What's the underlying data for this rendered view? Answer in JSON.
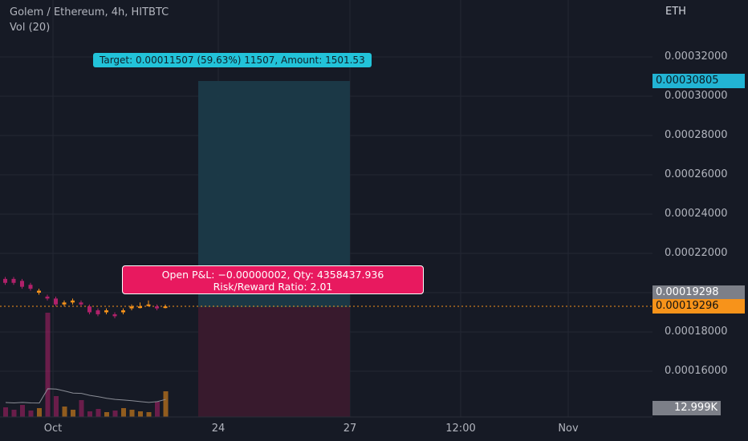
{
  "header": {
    "title": "Golem / Ethereum, 4h, HITBTC",
    "indicator": "Vol (20)"
  },
  "axis": {
    "currency": "ETH",
    "y_ticks": [
      "0.00032000",
      "0.00030000",
      "0.00028000",
      "0.00026000",
      "0.00024000",
      "0.00022000",
      "0.00018000",
      "0.00016000"
    ],
    "x_ticks": [
      "Oct",
      "24",
      "27",
      "12:00",
      "Nov"
    ]
  },
  "price_labels": {
    "last": "0.00019298",
    "current": "0.00019296",
    "target": "0.00030805",
    "volume": "12.999K"
  },
  "position": {
    "target_text": "Target: 0.00011507 (59.63%) 11507, Amount: 1501.53",
    "pnl_text": "Open P&L: −0.00000002, Qty: 4358437.936",
    "rr_text": "Risk/Reward Ratio: 2.01"
  },
  "colors": {
    "background": "#161a25",
    "grid": "#242833",
    "up": "#f7931a",
    "down": "#b0216a",
    "target_zone": "#1b3a48",
    "stop_zone": "#3a1a2d",
    "price_line": "#f7931a"
  },
  "chart_data": {
    "type": "candlestick",
    "title": "Golem / Ethereum, 4h, HITBTC",
    "ylim": [
      0.000148,
      0.000335
    ],
    "position": {
      "entry": 0.00019296,
      "target": 0.00030805,
      "stop": 0.000135
    },
    "candles": [
      {
        "i": 0,
        "o": 0.000205,
        "c": 0.000207,
        "h": 0.000208,
        "l": 0.000204,
        "up": false
      },
      {
        "i": 1,
        "o": 0.000207,
        "c": 0.000205,
        "h": 0.000208,
        "l": 0.000204,
        "up": false
      },
      {
        "i": 2,
        "o": 0.000206,
        "c": 0.000203,
        "h": 0.000207,
        "l": 0.000202,
        "up": false
      },
      {
        "i": 3,
        "o": 0.000204,
        "c": 0.000202,
        "h": 0.000205,
        "l": 0.000201,
        "up": false
      },
      {
        "i": 4,
        "o": 0.0002,
        "c": 0.000201,
        "h": 0.000202,
        "l": 0.000199,
        "up": true
      },
      {
        "i": 5,
        "o": 0.000198,
        "c": 0.000197,
        "h": 0.000199,
        "l": 0.000196,
        "up": false
      },
      {
        "i": 6,
        "o": 0.000197,
        "c": 0.000194,
        "h": 0.000198,
        "l": 0.000193,
        "up": false
      },
      {
        "i": 7,
        "o": 0.000194,
        "c": 0.000195,
        "h": 0.000196,
        "l": 0.000193,
        "up": true
      },
      {
        "i": 8,
        "o": 0.000195,
        "c": 0.000196,
        "h": 0.000197,
        "l": 0.000194,
        "up": true
      },
      {
        "i": 9,
        "o": 0.000195,
        "c": 0.000194,
        "h": 0.000196,
        "l": 0.000193,
        "up": false
      },
      {
        "i": 10,
        "o": 0.000193,
        "c": 0.00019,
        "h": 0.000194,
        "l": 0.000189,
        "up": false
      },
      {
        "i": 11,
        "o": 0.000191,
        "c": 0.000189,
        "h": 0.000192,
        "l": 0.000188,
        "up": false
      },
      {
        "i": 12,
        "o": 0.00019,
        "c": 0.000191,
        "h": 0.000192,
        "l": 0.000189,
        "up": true
      },
      {
        "i": 13,
        "o": 0.000189,
        "c": 0.000188,
        "h": 0.00019,
        "l": 0.000187,
        "up": false
      },
      {
        "i": 14,
        "o": 0.00019,
        "c": 0.000191,
        "h": 0.000192,
        "l": 0.000189,
        "up": true
      },
      {
        "i": 15,
        "o": 0.000192,
        "c": 0.000193,
        "h": 0.000194,
        "l": 0.000191,
        "up": true
      },
      {
        "i": 16,
        "o": 0.000193,
        "c": 0.000193,
        "h": 0.000195,
        "l": 0.000192,
        "up": true
      },
      {
        "i": 17,
        "o": 0.000194,
        "c": 0.000194,
        "h": 0.000196,
        "l": 0.000193,
        "up": true
      },
      {
        "i": 18,
        "o": 0.000193,
        "c": 0.000192,
        "h": 0.000194,
        "l": 0.000191,
        "up": false
      },
      {
        "i": 19,
        "o": 0.000193,
        "c": 0.000193,
        "h": 0.000194,
        "l": 0.000192,
        "up": true
      }
    ],
    "volume": [
      1200,
      900,
      1500,
      800,
      1100,
      12999,
      2600,
      1300,
      900,
      2100,
      700,
      1000,
      600,
      800,
      1100,
      900,
      700,
      600,
      1900,
      3200
    ]
  }
}
